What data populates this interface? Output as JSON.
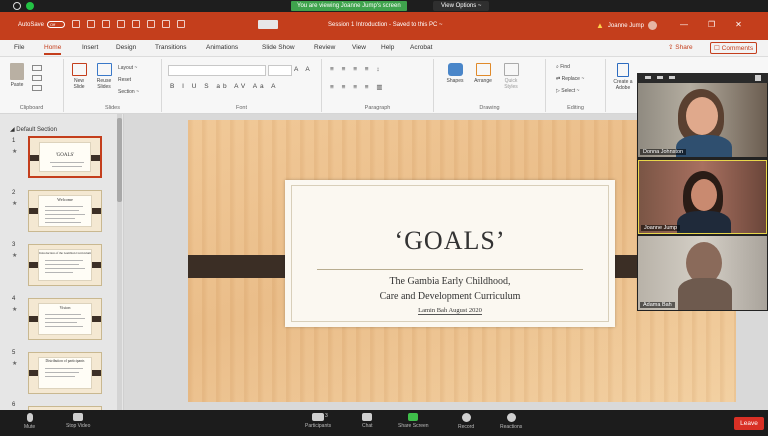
{
  "zoom": {
    "share_banner": "You are viewing Joanne Jump's screen",
    "view_options": "View Options ~",
    "toolbar": {
      "mute": "Mute",
      "stop_video": "Stop Video",
      "participants": "Participants",
      "participants_count": "3",
      "chat": "Chat",
      "share_screen": "Share Screen",
      "record": "Record",
      "reactions": "Reactions",
      "leave": "Leave"
    },
    "participants": [
      {
        "name": "Donna Johnston"
      },
      {
        "name": "Joanne Jump"
      },
      {
        "name": "Adama Bah"
      }
    ]
  },
  "powerpoint": {
    "autosave_label": "AutoSave",
    "autosave_state": "Off",
    "doc_title": "Session 1 Introduction - Saved to this PC ~",
    "user_name": "Joanne Jump",
    "tabs": [
      "File",
      "Home",
      "Insert",
      "Design",
      "Transitions",
      "Animations",
      "Slide Show",
      "Review",
      "View",
      "Help",
      "Acrobat"
    ],
    "share": "Share",
    "comments": "Comments",
    "ribbon": {
      "clipboard": "Clipboard",
      "paste": "Paste",
      "slides": "Slides",
      "new_slide": "New Slide",
      "reuse_slides": "Reuse Slides",
      "layout": "Layout ~",
      "reset": "Reset",
      "section": "Section ~",
      "font": "Font",
      "paragraph": "Paragraph",
      "drawing": "Drawing",
      "shapes": "Shapes",
      "arrange": "Arrange",
      "quick_styles": "Quick Styles",
      "editing": "Editing",
      "find": "Find",
      "replace": "Replace ~",
      "select": "Select ~",
      "create": "Create a",
      "adobe": "Adobe"
    },
    "section_name": "Default Section",
    "thumbnails": [
      {
        "num": "1",
        "title": "'GOALS'"
      },
      {
        "num": "2",
        "title": "Welcome"
      },
      {
        "num": "3",
        "title": "Introduction of the Gambian Curriculum"
      },
      {
        "num": "4",
        "title": "Vision"
      },
      {
        "num": "5",
        "title": "Distribution of participants"
      },
      {
        "num": "6",
        "title": ""
      }
    ],
    "slide": {
      "title": "‘GOALS’",
      "subtitle1": "The Gambia Early Childhood,",
      "subtitle2": "Care and Development Curriculum",
      "author": "Lamin Bah August 2020"
    }
  },
  "colors": {
    "ppt_red": "#c43e1c",
    "zoom_green": "#3fa34d",
    "leave_red": "#d93025",
    "slide_band": "#3b2e25"
  }
}
